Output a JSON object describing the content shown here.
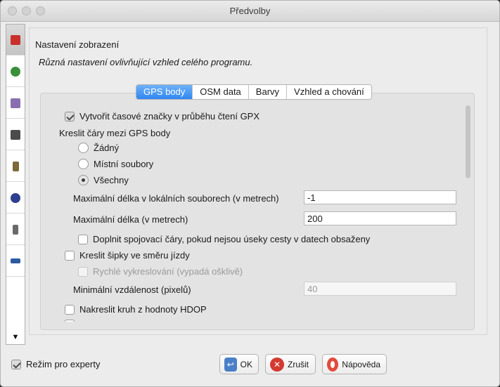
{
  "window": {
    "title": "Předvolby"
  },
  "sidebar": {
    "items": [
      {
        "icon": "display-settings-icon",
        "color": "#c9302c"
      },
      {
        "icon": "globe-icon",
        "color": "#3a8f3a"
      },
      {
        "icon": "map-style-icon",
        "color": "#8a6fb0"
      },
      {
        "icon": "plugin-icon",
        "color": "#4b4b4b"
      },
      {
        "icon": "lock-icon",
        "color": "#7a6a3a"
      },
      {
        "icon": "shortcuts-icon",
        "color": "#2f3f8f"
      },
      {
        "icon": "remote-control-icon",
        "color": "#6a6a6a"
      },
      {
        "icon": "connection-icon",
        "color": "#2c5aa0"
      }
    ],
    "scroll_arrow": "▼"
  },
  "header": {
    "title": "Nastavení zobrazení",
    "description": "Různá nastavení ovlivňující vzhled celého programu."
  },
  "tabs": [
    {
      "label": "GPS body",
      "selected": true
    },
    {
      "label": "OSM data",
      "selected": false
    },
    {
      "label": "Barvy",
      "selected": false
    },
    {
      "label": "Vzhled a chování",
      "selected": false
    }
  ],
  "gps": {
    "timestamps": {
      "label": "Vytvořit časové značky v průběhu čtení GPX",
      "checked": true
    },
    "draw_lines_label": "Kreslit čáry mezi GPS body",
    "radios": [
      {
        "label": "Žádný",
        "checked": false
      },
      {
        "label": "Místní soubory",
        "checked": false
      },
      {
        "label": "Všechny",
        "checked": true
      }
    ],
    "max_local": {
      "label": "Maximální délka v lokálních souborech (v metrech)",
      "value": "-1"
    },
    "max_len": {
      "label": "Maximální délka (v metrech)",
      "value": "200"
    },
    "fill_lines": {
      "label": "Doplnit spojovací čáry, pokud nejsou úseky cesty v datech obsaženy",
      "checked": false
    },
    "arrows": {
      "label": "Kreslit šipky ve směru jízdy",
      "checked": false
    },
    "fast_draw": {
      "label": "Rychlé vykreslování (vypadá ošklivě)",
      "checked": false
    },
    "min_dist": {
      "label": "Minimální vzdálenost (pixelů)",
      "value": "40"
    },
    "hdop": {
      "label": "Nakreslit kruh z hodnoty HDOP",
      "checked": false
    }
  },
  "footer": {
    "expert": {
      "label": "Režim pro experty",
      "checked": true
    },
    "ok": "OK",
    "cancel": "Zrušit",
    "help": "Nápověda"
  }
}
